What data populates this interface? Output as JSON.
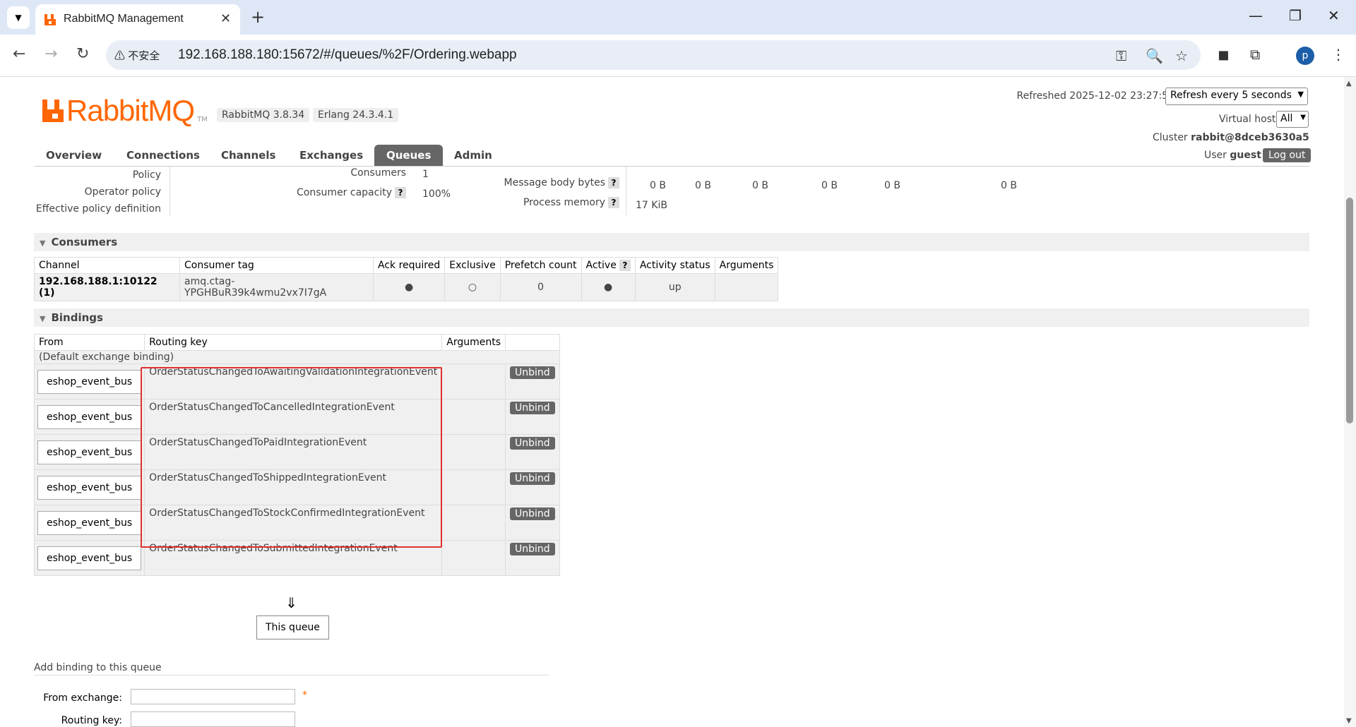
{
  "browser": {
    "tab_title": "RabbitMQ Management",
    "security_label": "不安全",
    "url": "192.168.188.180:15672/#/queues/%2F/Ordering.webapp",
    "profile_initial": "p"
  },
  "header": {
    "logo_text": "RabbitMQ",
    "logo_tm": "TM",
    "version": "RabbitMQ 3.8.34",
    "erlang": "Erlang 24.3.4.1",
    "refreshed": "Refreshed 2025-12-02 23:27:57",
    "refresh_option": "Refresh every 5 seconds",
    "vhost_label": "Virtual host",
    "vhost_value": "All",
    "cluster_label": "Cluster",
    "cluster_value": "rabbit@8dceb3630a5",
    "user_label": "User",
    "user_value": "guest",
    "logout": "Log out"
  },
  "nav": [
    "Overview",
    "Connections",
    "Channels",
    "Exchanges",
    "Queues",
    "Admin"
  ],
  "details": {
    "policy": "Policy",
    "operator_policy": "Operator policy",
    "effective_policy": "Effective policy definition",
    "consumers_label": "Consumers",
    "consumers_value": "1",
    "capacity_label": "Consumer capacity",
    "capacity_value": "100%",
    "body_bytes_label": "Message body bytes",
    "process_memory_label": "Process memory",
    "process_memory_value": "17 KiB",
    "bytes": [
      "0 B",
      "0 B",
      "0 B",
      "0 B",
      "0 B",
      "0 B"
    ]
  },
  "consumers": {
    "title": "Consumers",
    "headers": [
      "Channel",
      "Consumer tag",
      "Ack required",
      "Exclusive",
      "Prefetch count",
      "Active",
      "Activity status",
      "Arguments"
    ],
    "row": {
      "channel": "192.168.188.1:10122 (1)",
      "tag": "amq.ctag-YPGHBuR39k4wmu2vx7I7gA",
      "ack": "●",
      "exclusive": "○",
      "prefetch": "0",
      "active": "●",
      "status": "up",
      "args": ""
    }
  },
  "bindings": {
    "title": "Bindings",
    "headers": [
      "From",
      "Routing key",
      "Arguments"
    ],
    "default_row": "(Default exchange binding)",
    "unbind": "Unbind",
    "rows": [
      {
        "from": "eshop_event_bus",
        "key": "OrderStatusChangedToAwaitingValidationIntegrationEvent"
      },
      {
        "from": "eshop_event_bus",
        "key": "OrderStatusChangedToCancelledIntegrationEvent"
      },
      {
        "from": "eshop_event_bus",
        "key": "OrderStatusChangedToPaidIntegrationEvent"
      },
      {
        "from": "eshop_event_bus",
        "key": "OrderStatusChangedToShippedIntegrationEvent"
      },
      {
        "from": "eshop_event_bus",
        "key": "OrderStatusChangedToStockConfirmedIntegrationEvent"
      },
      {
        "from": "eshop_event_bus",
        "key": "OrderStatusChangedToSubmittedIntegrationEvent"
      }
    ],
    "arrow": "⇓",
    "this_queue": "This queue"
  },
  "add_binding": {
    "title": "Add binding to this queue",
    "from_label": "From exchange:",
    "key_label": "Routing key:",
    "required": "*"
  }
}
